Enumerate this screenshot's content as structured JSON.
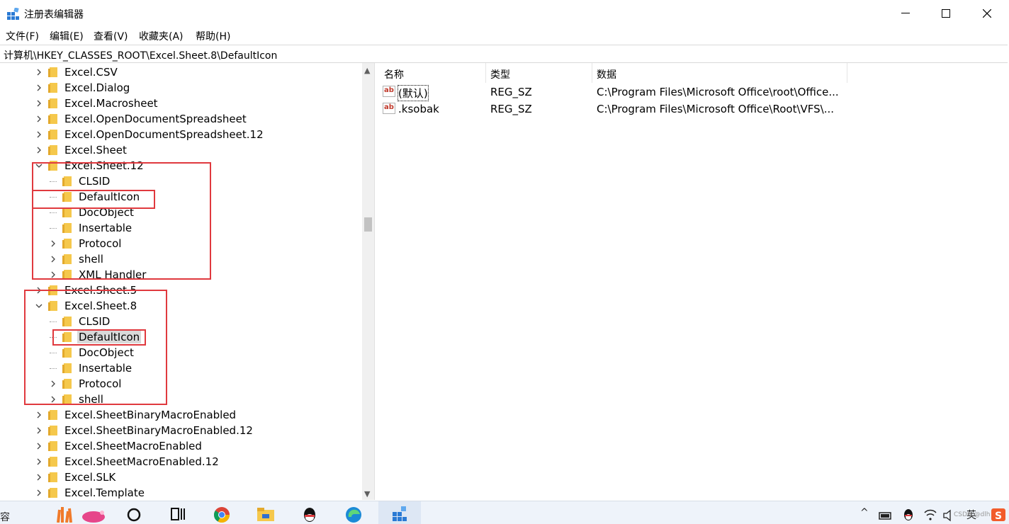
{
  "window": {
    "title": "注册表编辑器",
    "app_icon": "registry-editor-icon"
  },
  "menu": [
    "文件(F)",
    "编辑(E)",
    "查看(V)",
    "收藏夹(A)",
    "帮助(H)"
  ],
  "address": "计算机\\HKEY_CLASSES_ROOT\\Excel.Sheet.8\\DefaultIcon",
  "tree": [
    {
      "label": "Excel.CSV",
      "level": 0,
      "chev": "right"
    },
    {
      "label": "Excel.Dialog",
      "level": 0,
      "chev": "right"
    },
    {
      "label": "Excel.Macrosheet",
      "level": 0,
      "chev": "right"
    },
    {
      "label": "Excel.OpenDocumentSpreadsheet",
      "level": 0,
      "chev": "right"
    },
    {
      "label": "Excel.OpenDocumentSpreadsheet.12",
      "level": 0,
      "chev": "right"
    },
    {
      "label": "Excel.Sheet",
      "level": 0,
      "chev": "right"
    },
    {
      "label": "Excel.Sheet.12",
      "level": 0,
      "chev": "down"
    },
    {
      "label": "CLSID",
      "level": 1,
      "chev": "none"
    },
    {
      "label": "DefaultIcon",
      "level": 1,
      "chev": "none"
    },
    {
      "label": "DocObject",
      "level": 1,
      "chev": "none"
    },
    {
      "label": "Insertable",
      "level": 1,
      "chev": "none"
    },
    {
      "label": "Protocol",
      "level": 1,
      "chev": "right"
    },
    {
      "label": "shell",
      "level": 1,
      "chev": "right"
    },
    {
      "label": "XML Handler",
      "level": 1,
      "chev": "right"
    },
    {
      "label": "Excel.Sheet.5",
      "level": 0,
      "chev": "right"
    },
    {
      "label": "Excel.Sheet.8",
      "level": 0,
      "chev": "down"
    },
    {
      "label": "CLSID",
      "level": 1,
      "chev": "none"
    },
    {
      "label": "DefaultIcon",
      "level": 1,
      "chev": "none",
      "selected": true
    },
    {
      "label": "DocObject",
      "level": 1,
      "chev": "none"
    },
    {
      "label": "Insertable",
      "level": 1,
      "chev": "none"
    },
    {
      "label": "Protocol",
      "level": 1,
      "chev": "right"
    },
    {
      "label": "shell",
      "level": 1,
      "chev": "right"
    },
    {
      "label": "Excel.SheetBinaryMacroEnabled",
      "level": 0,
      "chev": "right"
    },
    {
      "label": "Excel.SheetBinaryMacroEnabled.12",
      "level": 0,
      "chev": "right"
    },
    {
      "label": "Excel.SheetMacroEnabled",
      "level": 0,
      "chev": "right"
    },
    {
      "label": "Excel.SheetMacroEnabled.12",
      "level": 0,
      "chev": "right"
    },
    {
      "label": "Excel.SLK",
      "level": 0,
      "chev": "right"
    },
    {
      "label": "Excel.Template",
      "level": 0,
      "chev": "right"
    }
  ],
  "list": {
    "columns": [
      "名称",
      "类型",
      "数据"
    ],
    "rows": [
      {
        "name": "(默认)",
        "type": "REG_SZ",
        "data": "C:\\Program Files\\Microsoft Office\\root\\Office..."
      },
      {
        "name": ".ksobak",
        "type": "REG_SZ",
        "data": "C:\\Program Files\\Microsoft Office\\Root\\VFS\\..."
      }
    ]
  },
  "taskbar": {
    "left_text": "容",
    "tray_text": "^",
    "lang": "英",
    "watermark": "CSDN @dlh"
  },
  "colors": {
    "highlight_box": "#e0393e",
    "folder": "#f5c84c",
    "selection": "#d9d9d9"
  }
}
